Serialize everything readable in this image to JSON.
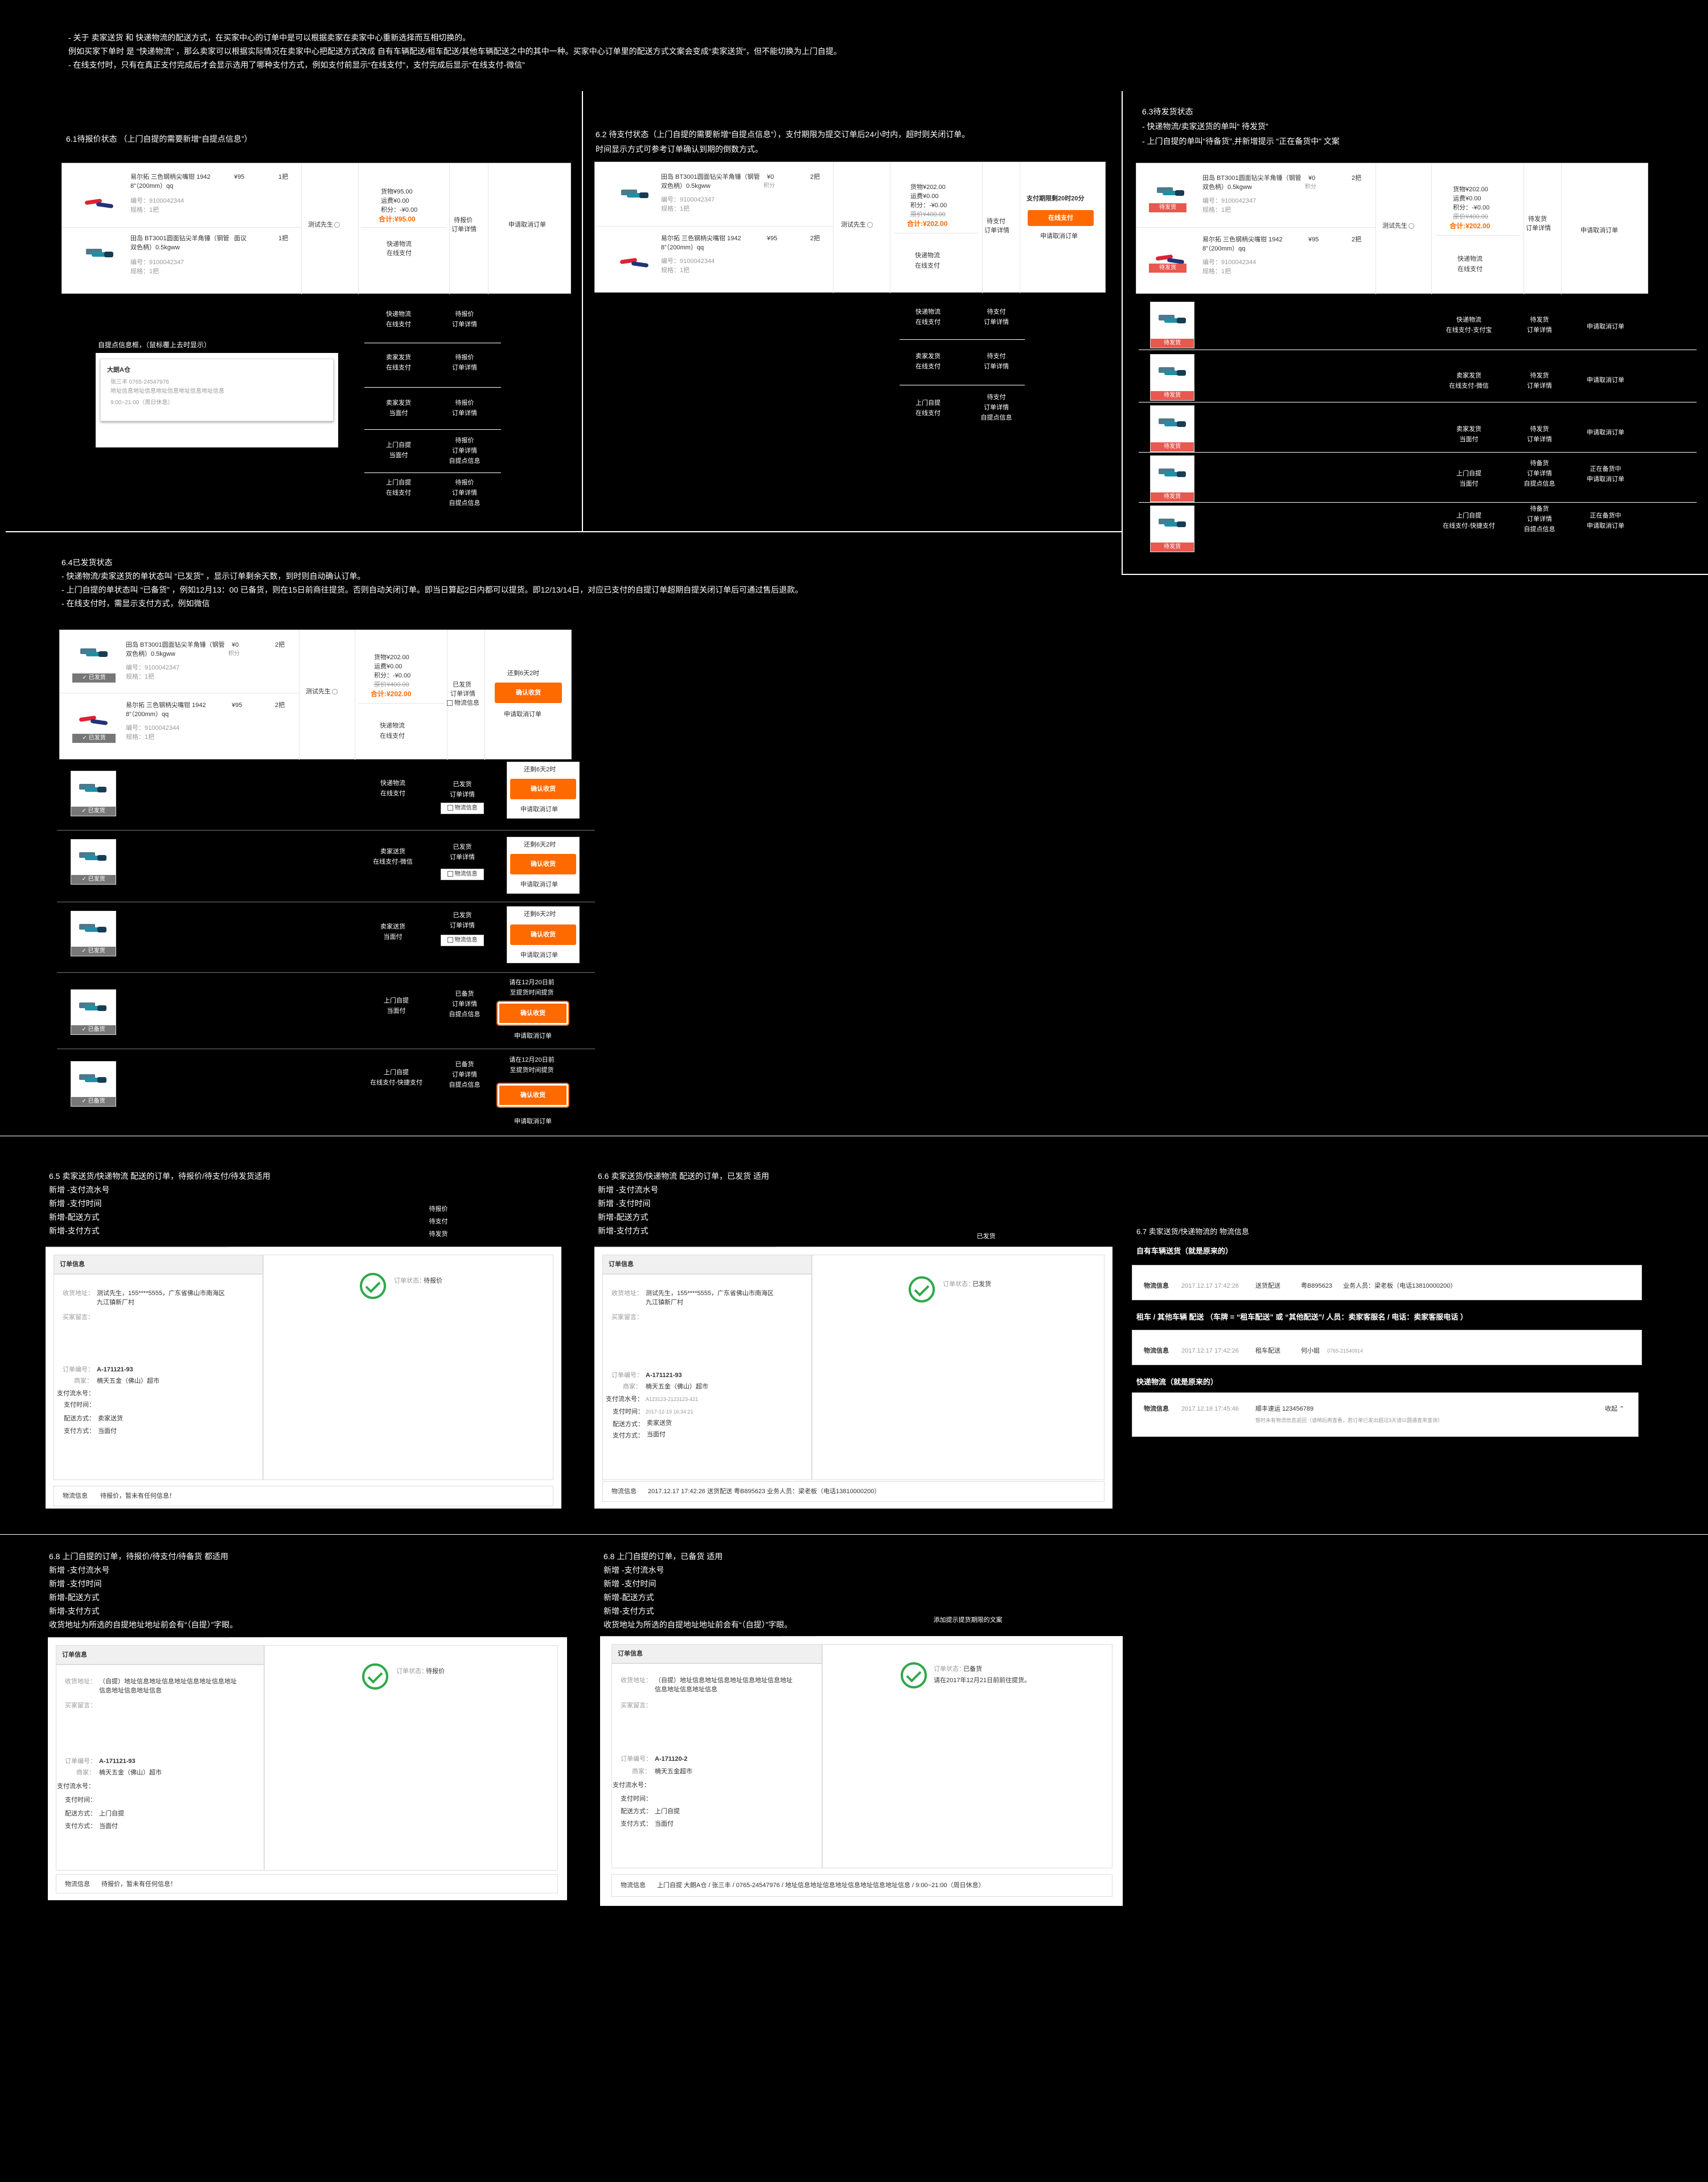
{
  "top_notes": [
    "- 关于 卖家送货 和 快递物流的配送方式，在买家中心的订单中是可以根据卖家在卖家中心重新选择而互相切换的。",
    "  例如买家下单时 是 “快递物流” ，那么卖家可以根据实际情况在卖家中心把配送方式改成 自有车辆配送/租车配送/其他车辆配送之中的其中一种。买家中心订单里的配送方式文案会变成“卖家送货”，但不能切换为上门自提。",
    "- 在线支付时，只有在真正支付完成后才会显示选用了哪种支付方式，例如支付前显示“在线支付”，支付完成后显示“在线支付-微信”"
  ],
  "s61": {
    "title": "6.1待报价状态 （上门自提的需要新增“自提点信息”）"
  },
  "s62": {
    "title": "6.2 待支付状态（上门自提的需要新增“自提点信息”），支付期限为提交订单后24小时内，超时则关闭订单。",
    "sub": "   时间显示方式可参考订单确认到期的倒数方式。"
  },
  "s63": {
    "title": "6.3待发货状态",
    "l1": "- 快递物流/卖家送货的单叫“ 待发货”",
    "l2": "- 上门自提的单叫“待备货”,并新增提示 “正在备货中” 文案"
  },
  "s64": {
    "title": "6.4已发货状态",
    "l1": "- 快递物流/卖家送货的单状态叫 “已发货” ，显示订单剩余天数，到时则自动确认订单。",
    "l2": "- 上门自提的单状态叫 “已备货” ，例如12月13：00 已备货，则在15日前商往提货。否则自动关闭订单。即当日算起2日内都可以提货。即12/13/14日，对应已支付的自提订单超期自提关闭订单后可通过售后退款。",
    "l3": "-  在线支付时，需显示支付方式，例如微信"
  },
  "products": {
    "p1": {
      "name": "易尔拓 三色钢柄尖嘴钳 1942 8”（200mm）qq",
      "code": "编号：9100042344",
      "spec": "规格：1把",
      "price": "¥95",
      "qty": "1把"
    },
    "p2": {
      "name": "田岛 BT3001圆面钻尖羊角锤（钢管双色柄）0.5kgww",
      "code": "编号：9100042347",
      "spec": "规格：1把",
      "price": "面议",
      "qty": "1把"
    },
    "p3": {
      "name": "田岛 BT3001圆面钻尖羊角锤（钢管双色柄）0.5kgww",
      "code": "编号：9100042347",
      "spec": "规格：1把",
      "price": "¥0",
      "qty": "2把",
      "sub": "积分"
    },
    "p4": {
      "name": "易尔拓 三色钢柄尖嘴钳 1942 8”（200mm）qq",
      "code": "编号：9100042344",
      "spec": "规格：1把",
      "price": "¥95",
      "qty": "2把"
    }
  },
  "price61": {
    "a": "货物¥95.00",
    "b": "运费¥0.00",
    "c": "积分：-¥0.00",
    "total": "合计:¥95.00",
    "ship": "快递物流",
    "pay": "在线支付"
  },
  "price62": {
    "a": "货物¥202.00",
    "b": "运费¥0.00",
    "c": "积分：-¥0.00",
    "d": "原价¥400.00",
    "total": "合计:¥202.00",
    "ship": "快递物流",
    "pay": "在线支付"
  },
  "buyer": "测试先生",
  "status": {
    "quote": "待报价",
    "detail": "订单详情",
    "cancel": "申请取消订单",
    "topay": "待支付",
    "pay_deadline": "支付期限剩20时20分",
    "online_pay": "在线支付",
    "tosend": "待发货",
    "toprep": "待备货",
    "prep": "正在备货中",
    "shipped": "已发货",
    "prepared": "已备货",
    "confirm": "确认收货",
    "remain": "还剩6天2时",
    "pickup_info": "自提点信息",
    "logistics": "物流信息",
    "deadline": "请在12月20日前",
    "deadline2": "至提货时间提货",
    "tag_send": "待发货",
    "tag_shipped": "已发货",
    "tag_prep": "已备货"
  },
  "ship_opts": {
    "exp": "快递物流",
    "seller": "卖家发货",
    "seller2": "卖家送货",
    "pickup": "上门自提",
    "online": "在线支付",
    "online_alipay": "在线支付-支付宝",
    "online_wechat": "在线支付-微信",
    "cod": "当面付",
    "online_express": "在线支付-快捷支付"
  },
  "tooltip": {
    "title": "自提点信息框，（鼠标覆上去时显示）",
    "name": "大朗A仓",
    "contact": "张三丰  0765-24547976",
    "addr": "地址信息地址信息地址信息地址信息地址信息",
    "hours": "9:00~21:00（周日休息）"
  },
  "s65": {
    "title": "6.5 卖家送货/快递物流 配送的订单，待报价/待支付/待发货适用",
    "f1": "新增 -支付流水号",
    "f2": "新增 -支付时间",
    "f3": "新增-配送方式",
    "f4": "新增-支付方式",
    "k1": "待报价",
    "k2": "待支付",
    "k3": "待发货"
  },
  "s66": {
    "title": "6.6 卖家送货/快递物流 配送的订单，已发货 适用",
    "f1": "新增 -支付流水号",
    "f2": "新增 -支付时间",
    "f3": "新增-配送方式",
    "f4": "新增-支付方式",
    "k1": "已发货"
  },
  "s67": {
    "title": "6.7  卖家送货/快递物流的 物流信息",
    "h1": "自有车辆送货（就是原来的）",
    "h2": "租车 / 其他车辆 配送     （车牌 = “租车配送” 或 “其他配送”/ 人员：卖家客服名 / 电话：卖家客服电话 ）",
    "h3": "快递物流（就是原来的）",
    "r1": {
      "lab": "物流信息",
      "time": "2017.12.17 17:42:26",
      "a": "送货配送",
      "b": "粤B895623",
      "c": "业务人员：梁老板（电话13810000200）"
    },
    "r2": {
      "lab": "物流信息",
      "time": "2017.12.17 17:42:26",
      "a": "租车配送",
      "b": "何小姐",
      "c": "0765-21540914"
    },
    "r3": {
      "lab": "物流信息",
      "time": "2017.12.19 17:45:46",
      "a": "顺丰速运 123456789",
      "note": "暂时未有物流信息返回（请稍后再查看，若订单已发出超过3天请以圆通查来查询）",
      "fold": "收起 ⌃"
    }
  },
  "s68a": {
    "title": "6.8 上门自提的订单，待报价/待支付/待备货 都适用",
    "f1": "新增 -支付流水号",
    "f2": "新增 -支付时间",
    "f3": "新增-配送方式",
    "f4": "新增-支付方式",
    "f5": "收货地址为所选的自提地址地址前会有“（自提）”字眼。"
  },
  "s68b": {
    "title": "6.8 上门自提的订单，已备货 适用",
    "f1": "新增 -支付流水号",
    "f2": "新增 -支付时间",
    "f3": "新增-配送方式",
    "f4": "新增-支付方式",
    "f5": "收货地址为所选的自提地址地址前会有“（自提）”字眼。",
    "note": "添加提示提货期限的文案"
  },
  "detail": {
    "hd": "订单信息",
    "addr_lab": "收货地址：",
    "addr": "测试先生，155****5555，广东省佛山市南海区九江镇新厂村",
    "msg_lab": "买家留言：",
    "order_lab": "订单编号：",
    "order": "A-171121-93",
    "shop_lab": "商家：",
    "shop": "楠天五金（佛山）超市",
    "paid_lab": "支付流水号：",
    "time_lab": "支付时间：",
    "ship_lab": "配送方式：",
    "ship": "卖家送货",
    "pay_lab": "支付方式：",
    "pay": "当面付",
    "state_lab": "订单状态：",
    "state_quote": "待报价",
    "state_ship": "已发货",
    "state_prep": "已备货",
    "prep_note": "请在2017年12月21日前前往提货。",
    "log_lab": "物流信息",
    "log_quote": "待报价，暂未有任何信息！",
    "log_ship": "2017.12.17 17:42:26    送货配送    粤B895623    业务人员：梁老板（电话13810000200）",
    "paid_no": "A123123-2123123-421",
    "paid_time": "2017-12-19  16:34:21",
    "pk_addr": "（自提）地址信息地址信息地址信息地址信息地址信息地址信息地址信息",
    "pk_ship": "上门自提",
    "order2": "A-171120-2",
    "shop2": "楠天五金超市",
    "pk_log": "上门自提  大朗A仓 / 张三丰 / 0765-24547976 / 地址信息地址信息地址信息地址信息地址信息 / 9:00~21:00（周日休息）"
  }
}
